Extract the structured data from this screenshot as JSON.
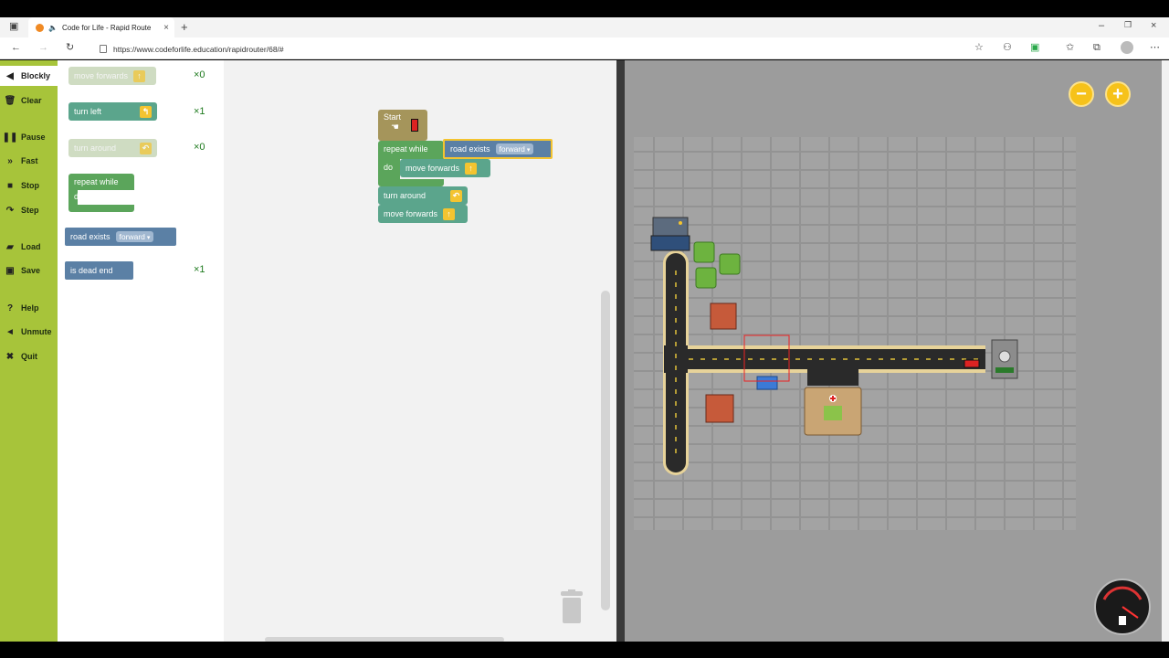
{
  "browser": {
    "tab_title": "Code for Life - Rapid Route",
    "tab_close": "×",
    "new_tab": "+",
    "url": "https://www.codeforlife.education/rapidrouter/68/#",
    "window_controls": [
      "–",
      "❐",
      "×"
    ]
  },
  "nav": {
    "items": [
      {
        "label": "Blockly",
        "icon": "blockly-icon"
      },
      {
        "label": "Clear",
        "icon": "trash-icon"
      },
      {
        "label": "Pause",
        "icon": "pause-icon"
      },
      {
        "label": "Fast",
        "icon": "fast-forward-icon"
      },
      {
        "label": "Stop",
        "icon": "stop-icon"
      },
      {
        "label": "Step",
        "icon": "step-icon"
      },
      {
        "label": "Load",
        "icon": "folder-icon"
      },
      {
        "label": "Save",
        "icon": "save-icon"
      },
      {
        "label": "Help",
        "icon": "help-icon"
      },
      {
        "label": "Unmute",
        "icon": "speaker-icon"
      },
      {
        "label": "Quit",
        "icon": "close-icon"
      }
    ]
  },
  "toolbox": {
    "move_forwards": "move forwards",
    "move_forwards_count": "×0",
    "turn_left": "turn left",
    "turn_left_count": "×1",
    "turn_around": "turn around",
    "turn_around_count": "×0",
    "repeat_while": "repeat while",
    "do": "do",
    "road_exists": "road exists",
    "forward": "forward",
    "is_dead_end": "is dead end",
    "is_dead_end_count": "×1"
  },
  "program": {
    "start": "Start",
    "repeat_while": "repeat while",
    "road_exists": "road exists",
    "forward": "forward",
    "do": "do",
    "move_forwards_inner": "move forwards",
    "turn_around": "turn around",
    "move_forwards": "move forwards"
  },
  "game": {
    "zoom_out": "−",
    "zoom_in": "+"
  },
  "colors": {
    "nav_green": "#a7c43a",
    "move_block": "#5ba58c",
    "logic_block": "#5b80a5",
    "loop_block": "#5ba55b",
    "start_block": "#a5955b",
    "road": "#2a2a2a",
    "road_edge": "#e7d39a"
  }
}
